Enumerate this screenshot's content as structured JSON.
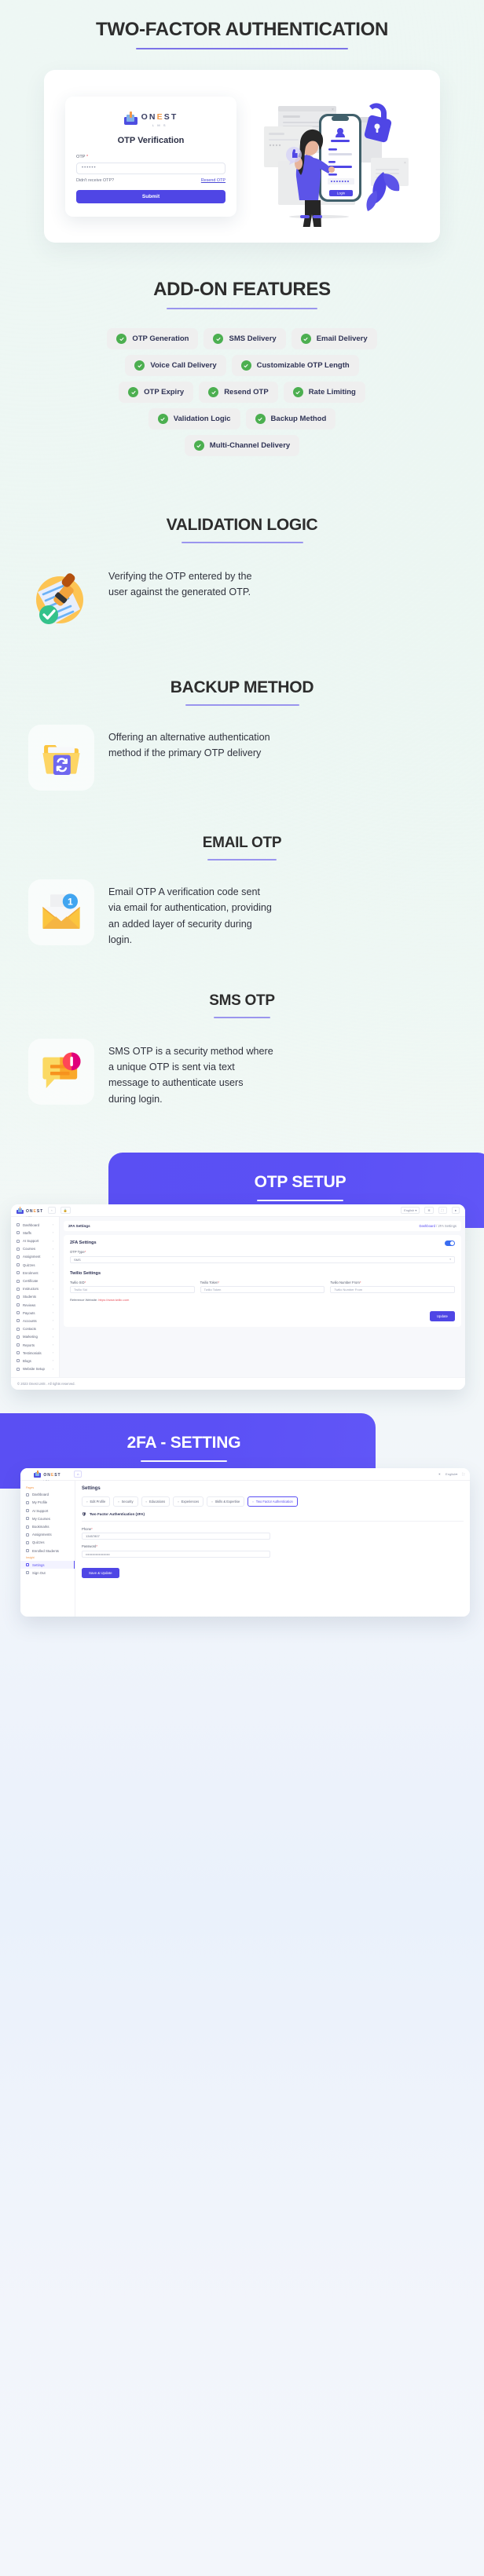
{
  "sections": {
    "hero": {
      "title": "TWO-FACTOR AUTHENTICATION",
      "otp_card": {
        "brand": "ONEST",
        "brand_sub": "L M S",
        "title": "OTP Verification",
        "otp_label": "OTP",
        "required_mark": "*",
        "otp_value": "••••••",
        "hint": "Didn't receive OTP?",
        "resend_link": "Resend OTP",
        "submit_label": "Submit"
      },
      "illustration": {
        "phone_login_button": "Login",
        "name": "two-factor-login-illustration"
      }
    },
    "addons": {
      "title": "ADD-ON FEATURES",
      "rows": [
        [
          "OTP Generation",
          "SMS Delivery",
          "Email Delivery"
        ],
        [
          "Voice Call Delivery",
          "Customizable OTP Length"
        ],
        [
          "OTP Expiry",
          "Resend OTP",
          "Rate Limiting"
        ],
        [
          "Validation Logic",
          "Backup Method"
        ],
        [
          "Multi-Channel Delivery"
        ]
      ]
    },
    "validation_logic": {
      "title": "VALIDATION LOGIC",
      "body": "Verifying the OTP entered by the user against the generated OTP.",
      "icon": "stamp-document-check-icon"
    },
    "backup_method": {
      "title": "BACKUP METHOD",
      "body": "Offering an alternative authentication method if the primary OTP delivery",
      "icon": "folder-sync-icon"
    },
    "email_otp": {
      "title": "EMAIL OTP",
      "body": "Email OTP A verification code sent via email for authentication, providing an added layer of security during login.",
      "icon": "envelope-notification-icon",
      "badge": "1"
    },
    "sms_otp": {
      "title": "SMS OTP",
      "body": "SMS OTP is a security method where a unique OTP is sent via text message to authenticate users during login.",
      "icon": "chat-bubble-alert-icon"
    },
    "otp_setup": {
      "banner_title": "OTP SETUP",
      "screenshot": {
        "topbar": {
          "brand": "ONEST",
          "brand_sub": "LMS",
          "back_icon": "chevron-left-icon",
          "lock_icon": "lock-icon",
          "language": "English",
          "language_caret": "▾",
          "gear_icon": "gear-icon",
          "fullscreen_icon": "fullscreen-icon",
          "avatar_icon": "avatar-icon"
        },
        "sidebar": [
          "Dashboard",
          "Staffs",
          "AI Support",
          "Courses",
          "Assignment",
          "Quizzes",
          "Enrolment",
          "Certificate",
          "Instructors",
          "Students",
          "Reviews",
          "Payouts",
          "Accounts",
          "Contacts",
          "Marketing",
          "Reports",
          "Testimonials",
          "Blogs",
          "Website Setup"
        ],
        "breadcrumb_title": "2FA Settings",
        "breadcrumb_home": "Dashboard",
        "breadcrumb_sep": "/",
        "breadcrumb_current": "2FA Settings",
        "panel_title": "2FA Settings",
        "otp_type_label": "OTP Type",
        "otp_type_value": "SMS",
        "twilio_title": "Twilio Settings",
        "fields": [
          {
            "label": "Twilio SID",
            "placeholder": "Twilio Sid"
          },
          {
            "label": "Twilio Token",
            "placeholder": "Twilio Token"
          },
          {
            "label": "Twilio Number From",
            "placeholder": "Twilio Number From"
          }
        ],
        "reference_label": "Reference Website:",
        "reference_link": "https://www.twilio.com",
        "update_button": "Update",
        "footer": "© 2023 Onest LMS . All rights reserved."
      }
    },
    "twofa_setting": {
      "banner_title": "2FA - SETTING",
      "screenshot": {
        "topbar": {
          "brand": "ONEST",
          "brand_sub": "LMS",
          "home_icon": "home-icon",
          "theme_icon": "sun-icon",
          "language": "English",
          "language_caret": "▾",
          "fullscreen_icon": "fullscreen-icon"
        },
        "sidebar_caption": "Pages",
        "sidebar": [
          "Dashboard",
          "My Profile",
          "AI Support",
          "My Courses",
          "Bookmarks",
          "Assignments",
          "Quizzes",
          "Enrolled Students"
        ],
        "sidebar_caption2": "Insight",
        "sidebar2": [
          "Settings",
          "Sign Out"
        ],
        "active_item": "Settings",
        "page_title": "Settings",
        "tabs": [
          "Edit Profile",
          "Security",
          "Educations",
          "Experiences",
          "Skills & Expertise",
          "Two Factor Authentication"
        ],
        "active_tab": "Two Factor Authentication",
        "section_title": "Two Factor Authentication (2FA)",
        "phone_label": "Phone",
        "phone_value": "13457807",
        "password_label": "Password",
        "password_value": "••••••••••••••••••••••",
        "save_button": "Save & Update"
      }
    }
  },
  "colors": {
    "accent": "#5a4ff3",
    "rule": "#7b73e8",
    "check_green": "#4caf50",
    "required_red": "#e8505b"
  }
}
